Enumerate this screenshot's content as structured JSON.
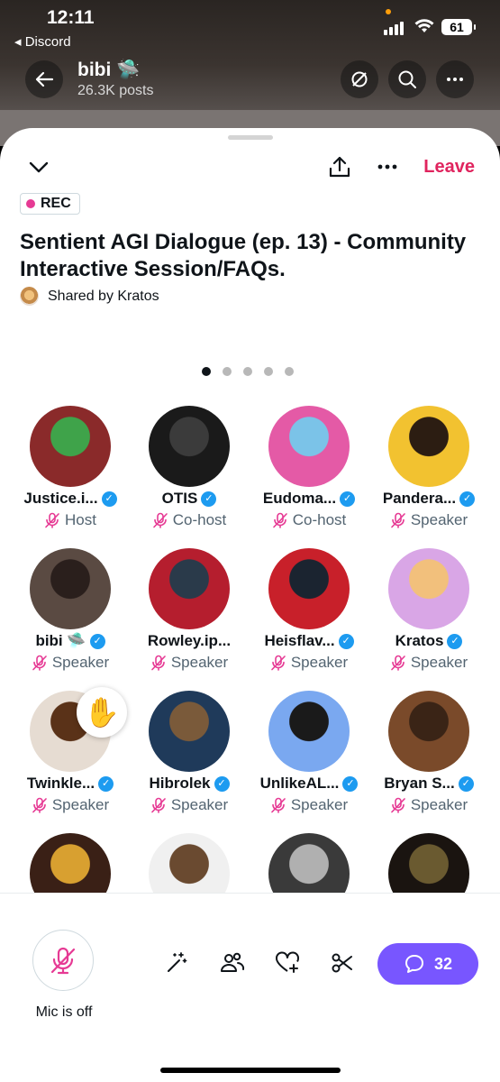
{
  "status_bar": {
    "time": "12:11",
    "back_app": "◂ Discord",
    "battery": "61"
  },
  "profile_header": {
    "name": "bibi 🛸",
    "posts": "26.3K posts"
  },
  "space": {
    "leave_label": "Leave",
    "rec_label": "REC",
    "title": "Sentient AGI Dialogue (ep. 13) - Community Interactive Session/FAQs.",
    "shared_by": "Shared by Kratos",
    "page_dots": {
      "count": 5,
      "active": 0
    }
  },
  "participants": [
    {
      "name": "Justice.i...",
      "role": "Host",
      "verified": true,
      "avatar_colors": [
        "#8a2a2a",
        "#3fa34a"
      ]
    },
    {
      "name": "OTIS",
      "role": "Co-host",
      "verified": true,
      "avatar_colors": [
        "#1a1a1a",
        "#3b3b3b"
      ]
    },
    {
      "name": "Eudoma...",
      "role": "Co-host",
      "verified": true,
      "avatar_colors": [
        "#e45aa6",
        "#7bc3e8"
      ]
    },
    {
      "name": "Pandera...",
      "role": "Speaker",
      "verified": true,
      "avatar_colors": [
        "#f2c230",
        "#2c1d12"
      ]
    },
    {
      "name": "bibi 🛸",
      "role": "Speaker",
      "verified": true,
      "avatar_colors": [
        "#5a4a42",
        "#2a1f1c"
      ]
    },
    {
      "name": "Rowley.ip...",
      "role": "Speaker",
      "verified": false,
      "avatar_colors": [
        "#b51e2e",
        "#2a3a4a"
      ]
    },
    {
      "name": "Heisflav...",
      "role": "Speaker",
      "verified": true,
      "avatar_colors": [
        "#c8202a",
        "#1b2430"
      ]
    },
    {
      "name": "Kratos",
      "role": "Speaker",
      "verified": true,
      "avatar_colors": [
        "#d9a6e6",
        "#f2c07c"
      ]
    },
    {
      "name": "Twinkle...",
      "role": "Speaker",
      "verified": true,
      "avatar_colors": [
        "#e6dcd2",
        "#5a3218"
      ],
      "hand_raised": true
    },
    {
      "name": "Hibrolek",
      "role": "Speaker",
      "verified": true,
      "avatar_colors": [
        "#1f3a5a",
        "#7a5a3a"
      ]
    },
    {
      "name": "UnlikeAL...",
      "role": "Speaker",
      "verified": true,
      "avatar_colors": [
        "#7aa8f0",
        "#1a1a1a"
      ]
    },
    {
      "name": "Bryan S...",
      "role": "Speaker",
      "verified": true,
      "avatar_colors": [
        "#7a4a2a",
        "#3a2416"
      ]
    },
    {
      "name": "",
      "role": "",
      "verified": false,
      "avatar_colors": [
        "#3a2016",
        "#d8a030"
      ]
    },
    {
      "name": "",
      "role": "",
      "verified": false,
      "avatar_colors": [
        "#f0f0f0",
        "#6a4a30"
      ]
    },
    {
      "name": "",
      "role": "",
      "verified": false,
      "avatar_colors": [
        "#3a3a3a",
        "#b0b0b0"
      ]
    },
    {
      "name": "",
      "role": "",
      "verified": false,
      "avatar_colors": [
        "#1a1410",
        "#6a5a30"
      ]
    }
  ],
  "bottom_bar": {
    "mic_label": "Mic is off",
    "chat_count": "32"
  },
  "colors": {
    "accent_red": "#e0245e",
    "mute_pink": "#e63a94",
    "verified_blue": "#1d9bf0",
    "chat_purple": "#7856ff"
  }
}
